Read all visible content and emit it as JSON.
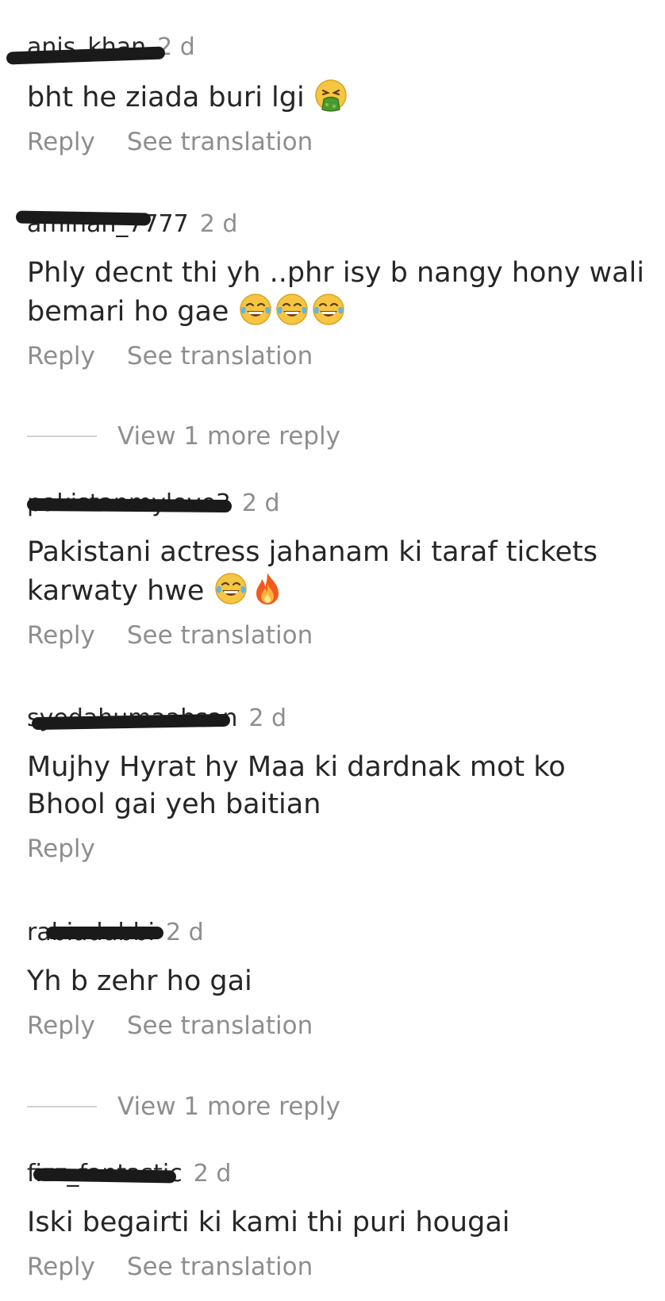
{
  "comments": [
    {
      "username": "anis_khan",
      "time": "2 d",
      "text": "bht he ziada buri lgi",
      "emojis": [
        "vomit-face"
      ],
      "reply_label": "Reply",
      "translate_label": "See translation"
    },
    {
      "username": "aminah_7777",
      "time": "2 d",
      "text": "Phly decnt thi yh ..phr isy b nangy hony wali bemari ho gae",
      "emojis": [
        "tears-of-joy",
        "tears-of-joy",
        "tears-of-joy"
      ],
      "reply_label": "Reply",
      "translate_label": "See translation"
    },
    {
      "username": "pakistanmylove3",
      "time": "2 d",
      "text": "Pakistani actress jahanam ki taraf tickets karwaty hwe",
      "emojis": [
        "tears-of-joy",
        "fire"
      ],
      "reply_label": "Reply",
      "translate_label": "See translation"
    },
    {
      "username": "syedahumaahsan",
      "time": "2 d",
      "text": "Mujhy Hyrat hy Maa ki dardnak mot ko Bhool gai yeh baitian",
      "emojis": [],
      "reply_label": "Reply",
      "translate_label": ""
    },
    {
      "username": "rabiadubbi",
      "time": "2 d",
      "text": "Yh b zehr ho gai",
      "emojis": [],
      "reply_label": "Reply",
      "translate_label": "See translation"
    },
    {
      "username": "fizz_fantastic",
      "time": "2 d",
      "text": "Iski begairti ki kami thi puri hougai",
      "emojis": [],
      "reply_label": "Reply",
      "translate_label": "See translation"
    }
  ],
  "view_more_replies": [
    {
      "label": "View 1 more reply"
    },
    {
      "label": "View 1 more reply"
    }
  ],
  "colors": {
    "primary_text": "#262626",
    "secondary_text": "#8e8e8e",
    "divider": "#d0d0d0",
    "redaction": "#1a1a1a"
  }
}
